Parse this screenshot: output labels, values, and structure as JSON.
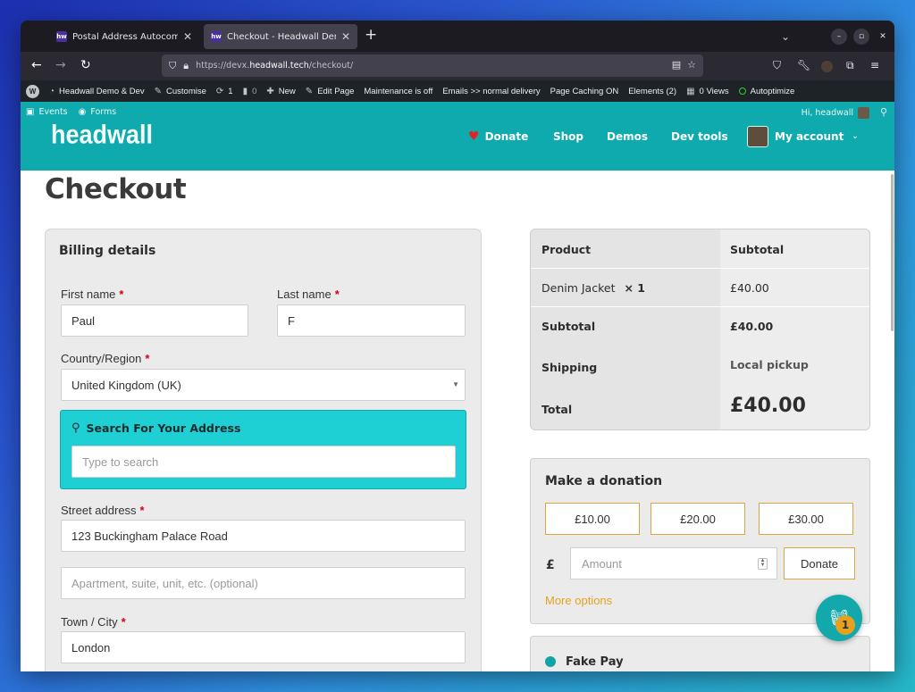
{
  "browser": {
    "tabs": [
      {
        "favicon": "hw",
        "title": "Postal Address Autocomplete",
        "active": false
      },
      {
        "favicon": "hw",
        "title": "Checkout - Headwall Demo & D",
        "active": true
      }
    ],
    "url_prefix": "https://devx.",
    "url_host": "headwall.tech",
    "url_path": "/checkout/"
  },
  "admin_bar": {
    "site_name": "Headwall Demo & Dev",
    "customise": "Customise",
    "updates_count": "1",
    "comments_count": "0",
    "new": "New",
    "edit_page": "Edit Page",
    "maintenance": "Maintenance is off",
    "emails": "Emails >> normal delivery",
    "page_caching": "Page Caching ON",
    "elements": "Elements (2)",
    "views": "0 Views",
    "autoptimize": "Autoptimize"
  },
  "site": {
    "top_links": [
      "Events",
      "Forms"
    ],
    "greeting": "Hi, headwall",
    "logo": "headwall",
    "nav": {
      "donate": "Donate",
      "shop": "Shop",
      "demos": "Demos",
      "dev_tools": "Dev tools",
      "my_account": "My account"
    },
    "colors": {
      "header": "#0eaaad",
      "accent": "#e8a021",
      "address_box": "#1ed0d3"
    }
  },
  "page": {
    "title": "Checkout"
  },
  "billing": {
    "heading": "Billing details",
    "required_mark": "*",
    "first_name": {
      "label": "First name",
      "value": "Paul"
    },
    "last_name": {
      "label": "Last name",
      "value": "F"
    },
    "country": {
      "label": "Country/Region",
      "value": "United Kingdom (UK)"
    },
    "address_search": {
      "heading": "Search For Your Address",
      "placeholder": "Type to search"
    },
    "street": {
      "label": "Street address",
      "value": "123 Buckingham Palace Road"
    },
    "street2": {
      "placeholder": "Apartment, suite, unit, etc. (optional)"
    },
    "city": {
      "label": "Town / City",
      "value": "London"
    }
  },
  "order": {
    "col_product": "Product",
    "col_subtotal": "Subtotal",
    "item_name": "Denim Jacket",
    "item_qty": "× 1",
    "item_total": "£40.00",
    "subtotal_label": "Subtotal",
    "subtotal_value": "£40.00",
    "shipping_label": "Shipping",
    "shipping_value": "Local pickup",
    "total_label": "Total",
    "total_value": "£40.00"
  },
  "donation": {
    "heading": "Make a donation",
    "amounts": [
      "£10.00",
      "£20.00",
      "£30.00"
    ],
    "currency": "£",
    "amount_placeholder": "Amount",
    "donate_button": "Donate",
    "more_options": "More options"
  },
  "payment": {
    "method": "Fake Pay"
  },
  "cart": {
    "count": "1"
  }
}
